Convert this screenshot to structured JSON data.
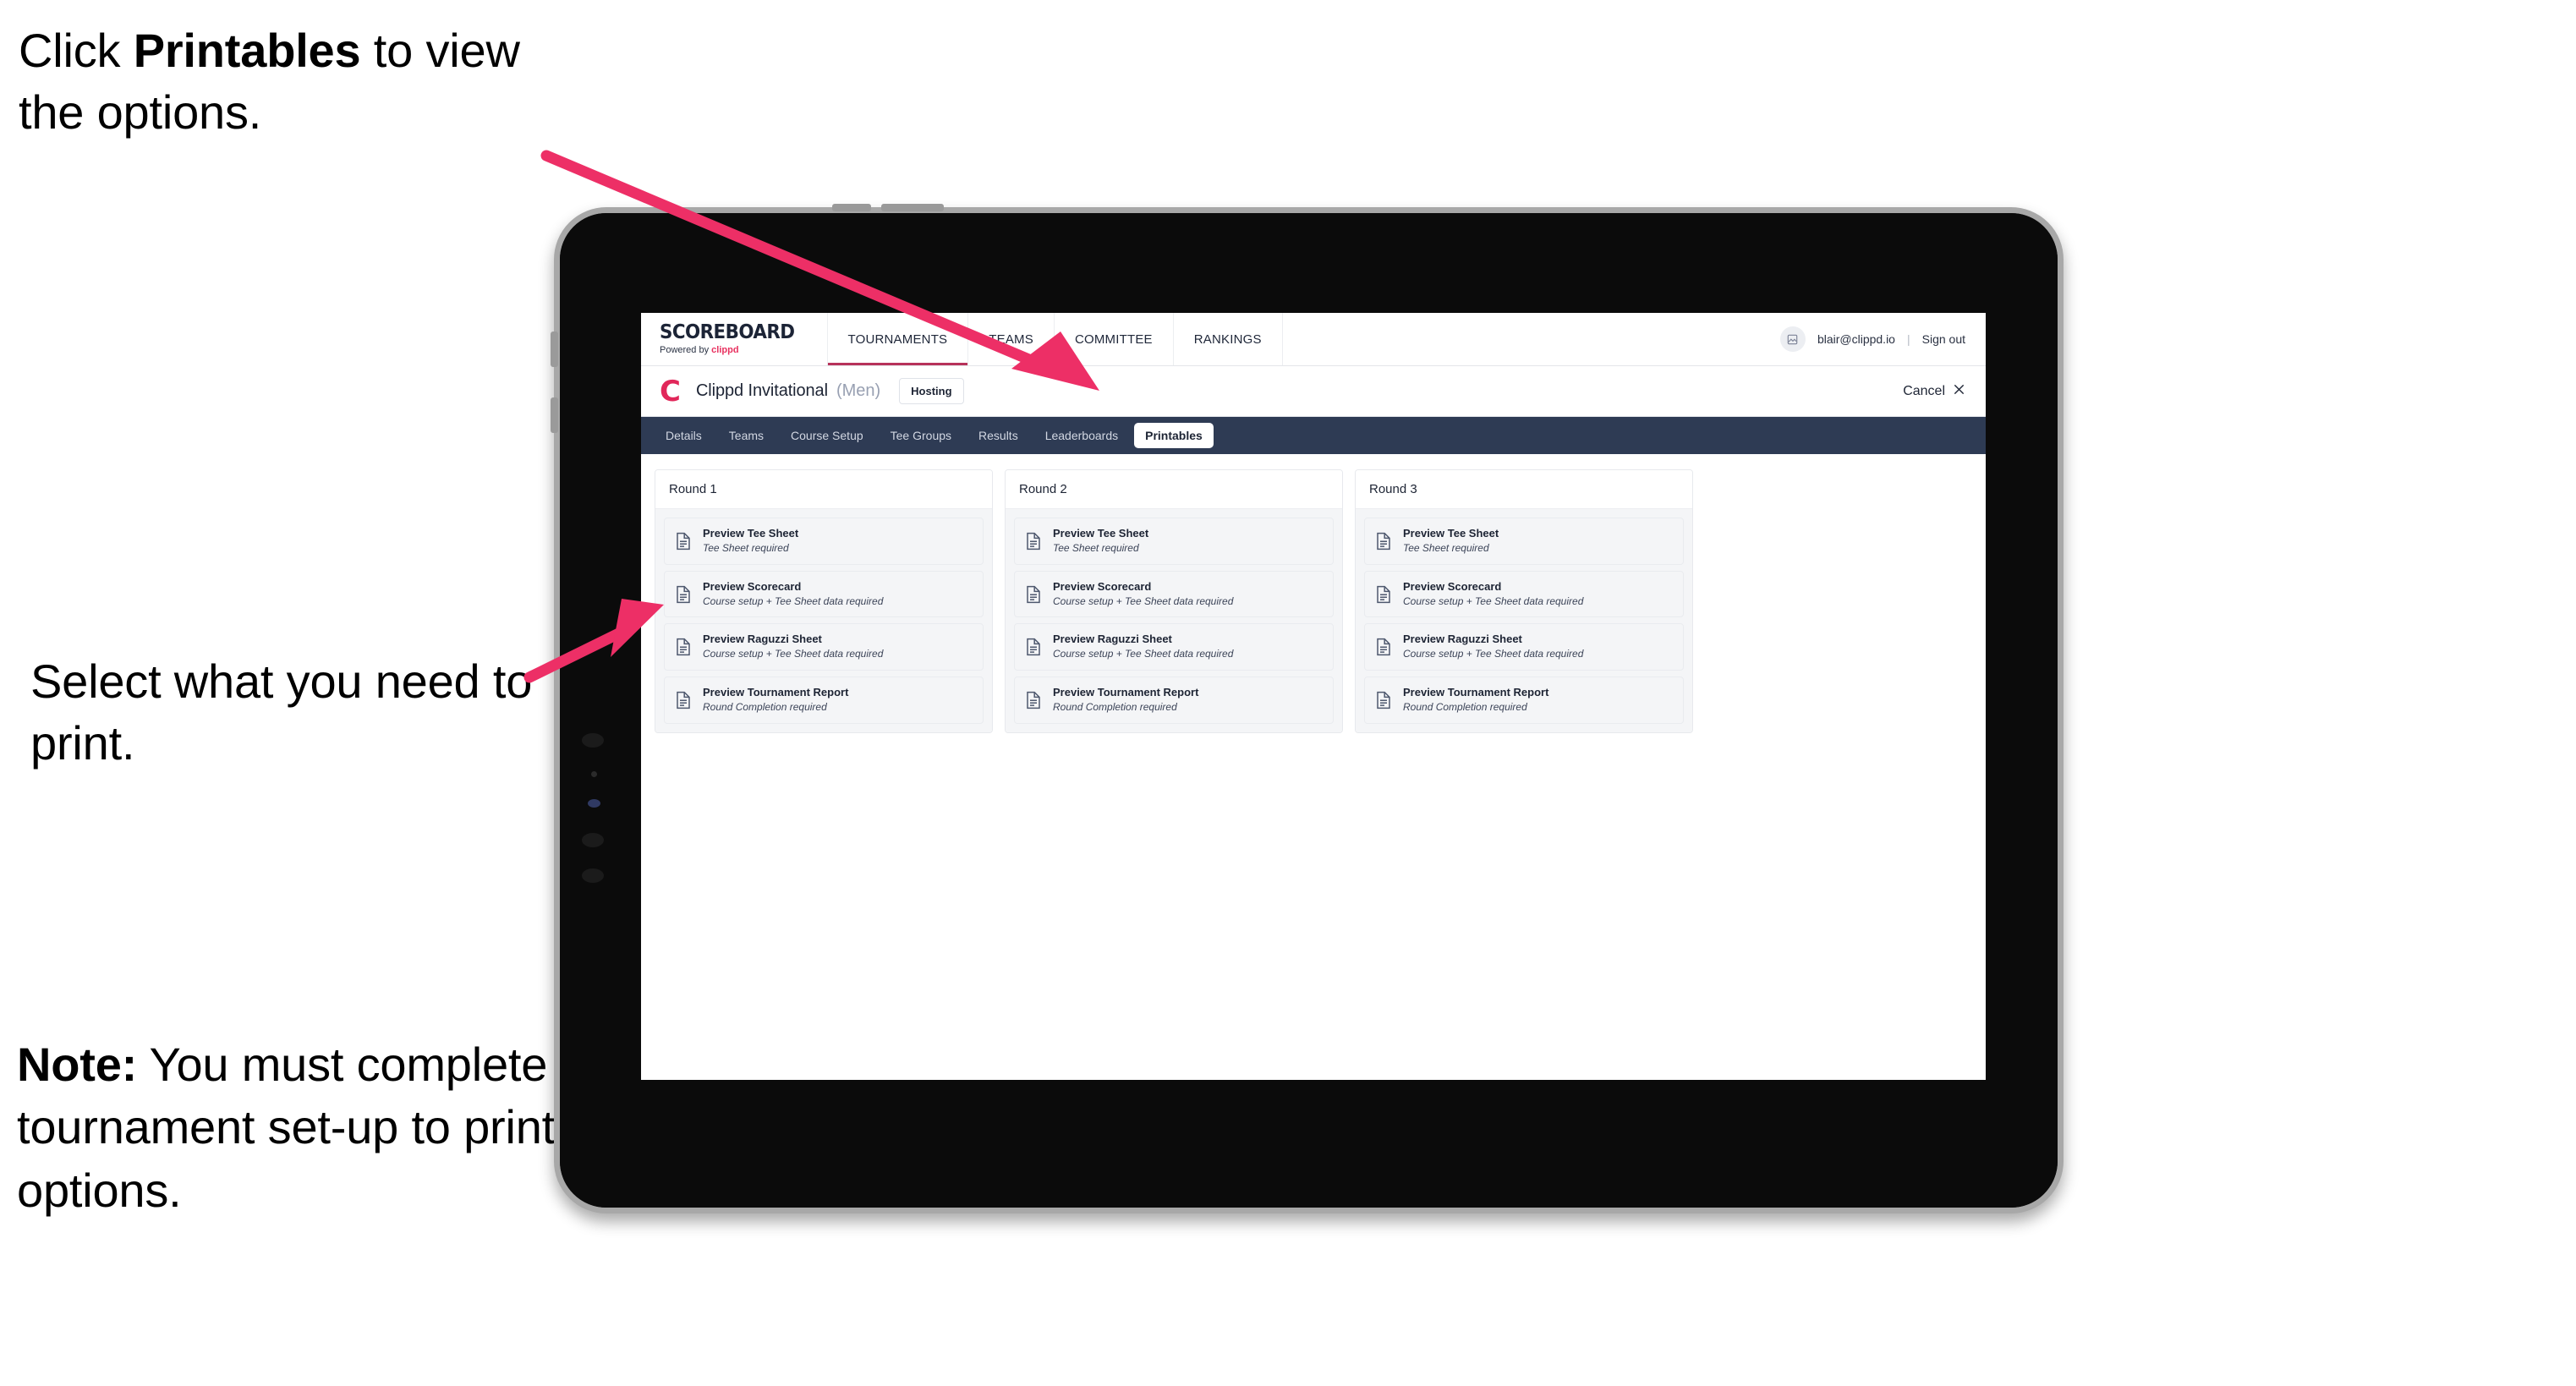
{
  "annotations": [
    {
      "id": "a1",
      "prefix": "Click ",
      "bold": "Printables",
      "suffix": " to view the options."
    },
    {
      "id": "a2",
      "prefix": "",
      "bold": "",
      "suffix": "Select what you need to print."
    },
    {
      "id": "a3",
      "prefix": "",
      "bold": "Note:",
      "suffix": " You must complete the tournament set-up to print all the options."
    }
  ],
  "arrows": {
    "color": "#ED2F66",
    "arrow_1_label": "arrow-to-printables-tab",
    "arrow_2_label": "arrow-to-printable-options"
  },
  "app": {
    "brand": {
      "name": "SCOREBOARD",
      "tagline_prefix": "Powered by ",
      "tagline_brand": "clippd"
    },
    "topnav": {
      "items": [
        {
          "label": "TOURNAMENTS",
          "active": true
        },
        {
          "label": "TEAMS",
          "active": false
        },
        {
          "label": "COMMITTEE",
          "active": false
        },
        {
          "label": "RANKINGS",
          "active": false
        }
      ],
      "user": {
        "avatar_icon": "user-avatar-icon",
        "email": "blair@clippd.io",
        "separator": "|",
        "signout": "Sign out"
      },
      "active_underline_color": "#B7325A"
    },
    "tournament": {
      "logo_letter": "C",
      "name": "Clippd Invitational",
      "gender": "(Men)",
      "status_chip": "Hosting",
      "cancel_label": "Cancel",
      "cancel_icon": "close-icon"
    },
    "subnav": {
      "background": "#2E3B54",
      "items": [
        {
          "label": "Details",
          "active": false
        },
        {
          "label": "Teams",
          "active": false
        },
        {
          "label": "Course Setup",
          "active": false
        },
        {
          "label": "Tee Groups",
          "active": false
        },
        {
          "label": "Results",
          "active": false
        },
        {
          "label": "Leaderboards",
          "active": false
        },
        {
          "label": "Printables",
          "active": true
        }
      ]
    },
    "printables": {
      "columns": [
        {
          "header": "Round 1",
          "rows": [
            {
              "icon": "document-icon",
              "title": "Preview Tee Sheet",
              "requirement": "Tee Sheet required"
            },
            {
              "icon": "document-icon",
              "title": "Preview Scorecard",
              "requirement": "Course setup + Tee Sheet data required"
            },
            {
              "icon": "document-icon",
              "title": "Preview Raguzzi Sheet",
              "requirement": "Course setup + Tee Sheet data required"
            },
            {
              "icon": "document-icon",
              "title": "Preview Tournament Report",
              "requirement": "Round Completion required"
            }
          ]
        },
        {
          "header": "Round 2",
          "rows": [
            {
              "icon": "document-icon",
              "title": "Preview Tee Sheet",
              "requirement": "Tee Sheet required"
            },
            {
              "icon": "document-icon",
              "title": "Preview Scorecard",
              "requirement": "Course setup + Tee Sheet data required"
            },
            {
              "icon": "document-icon",
              "title": "Preview Raguzzi Sheet",
              "requirement": "Course setup + Tee Sheet data required"
            },
            {
              "icon": "document-icon",
              "title": "Preview Tournament Report",
              "requirement": "Round Completion required"
            }
          ]
        },
        {
          "header": "Round 3",
          "rows": [
            {
              "icon": "document-icon",
              "title": "Preview Tee Sheet",
              "requirement": "Tee Sheet required"
            },
            {
              "icon": "document-icon",
              "title": "Preview Scorecard",
              "requirement": "Course setup + Tee Sheet data required"
            },
            {
              "icon": "document-icon",
              "title": "Preview Raguzzi Sheet",
              "requirement": "Course setup + Tee Sheet data required"
            },
            {
              "icon": "document-icon",
              "title": "Preview Tournament Report",
              "requirement": "Round Completion required"
            }
          ]
        }
      ]
    }
  }
}
